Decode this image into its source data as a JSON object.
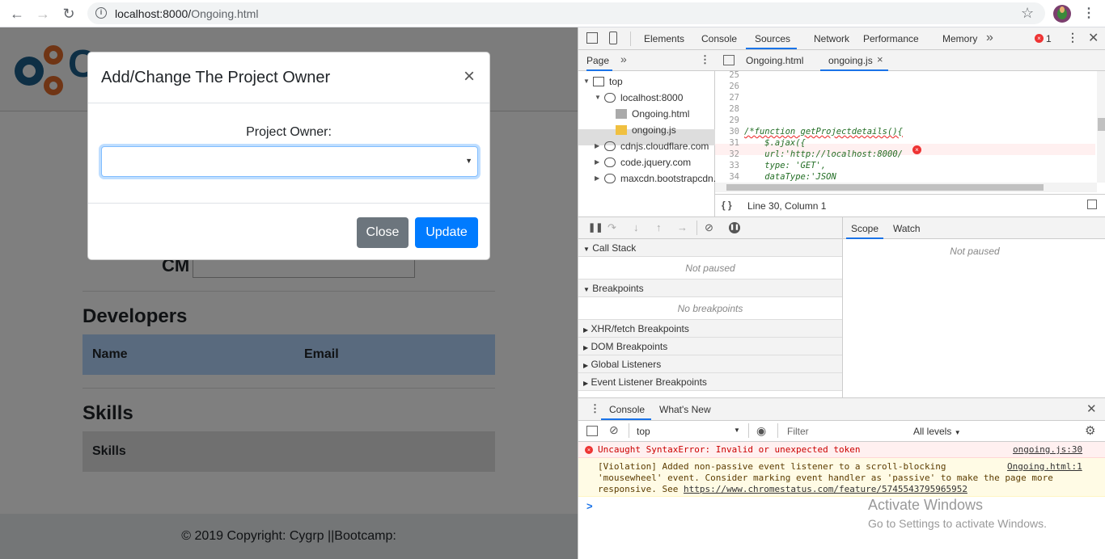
{
  "browser": {
    "url_host": "localhost:8000/",
    "url_path": "Ongoing.html"
  },
  "page": {
    "logo_text": "Cy",
    "cm_label": "CM",
    "developers_title": "Developers",
    "developers_columns": [
      "Name",
      "Email"
    ],
    "skills_title": "Skills",
    "skills_columns": [
      "Skills"
    ],
    "footer": "© 2019 Copyright: Cygrp ||Bootcamp:"
  },
  "modal": {
    "title": "Add/Change The Project Owner",
    "close_symbol": "×",
    "owner_label": "Project Owner:",
    "owner_value": "",
    "close_button": "Close",
    "update_button": "Update"
  },
  "devtools": {
    "tabs": [
      "Elements",
      "Console",
      "Sources",
      "Network",
      "Performance",
      "Memory"
    ],
    "active_tab": "Sources",
    "error_count": "1",
    "nav_tab": "Page",
    "tree": [
      {
        "label": "top",
        "indent": 0,
        "icon": "frame-icon"
      },
      {
        "label": "localhost:8000",
        "indent": 1,
        "icon": "cloud-icon"
      },
      {
        "label": "Ongoing.html",
        "indent": 2,
        "icon": "file-icon"
      },
      {
        "label": "ongoing.js",
        "indent": 2,
        "icon": "file-icon"
      },
      {
        "label": "cdnjs.cloudflare.com",
        "indent": 1,
        "icon": "cloud-icon"
      },
      {
        "label": "code.jquery.com",
        "indent": 1,
        "icon": "cloud-icon"
      },
      {
        "label": "maxcdn.bootstrapcdn.",
        "indent": 1,
        "icon": "cloud-icon"
      }
    ],
    "editor_tabs": [
      "Ongoing.html",
      "ongoing.js"
    ],
    "code_lines": [
      {
        "n": "25",
        "text": ""
      },
      {
        "n": "26",
        "text": ""
      },
      {
        "n": "27",
        "text": ""
      },
      {
        "n": "28",
        "text": ""
      },
      {
        "n": "29",
        "text": ""
      },
      {
        "n": "30",
        "text": "/*function getProjectdetails(){"
      },
      {
        "n": "31",
        "text": "    $.ajax({"
      },
      {
        "n": "32",
        "text": "    url:'http://localhost:8000/"
      },
      {
        "n": "33",
        "text": "    type: 'GET',"
      },
      {
        "n": "34",
        "text": "    dataType:'JSON"
      },
      {
        "n": "35",
        "text": ""
      }
    ],
    "cursor_status": "Line 30, Column 1",
    "call_stack": "Call Stack",
    "not_paused": "Not paused",
    "breakpoints": "Breakpoints",
    "no_breakpoints": "No breakpoints",
    "collapsed_panels": [
      "XHR/fetch Breakpoints",
      "DOM Breakpoints",
      "Global Listeners",
      "Event Listener Breakpoints"
    ],
    "scope_tab": "Scope",
    "watch_tab": "Watch",
    "scope_not_paused": "Not paused",
    "drawer_tabs": [
      "Console",
      "What's New"
    ],
    "context": "top",
    "filter_placeholder": "Filter",
    "levels": "All levels",
    "error_text": "Uncaught SyntaxError: Invalid or unexpected token",
    "error_source": "ongoing.js:30",
    "warn_line1": "[Violation] Added non-passive event listener to a scroll-blocking",
    "warn_source": "Ongoing.html:1",
    "warn_line2": "'mousewheel' event. Consider marking event handler as 'passive' to make the page more",
    "warn_line3_prefix": "responsive. See ",
    "warn_link": "https://www.chromestatus.com/feature/5745543795965952",
    "prompt": ">"
  },
  "watermark": {
    "title": "Activate Windows",
    "subtitle": "Go to Settings to activate Windows."
  }
}
